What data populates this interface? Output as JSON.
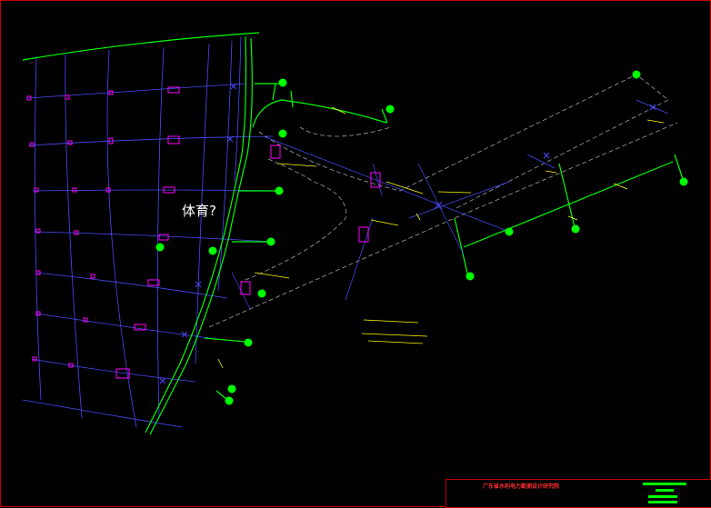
{
  "labels": {
    "big_text": "体育?"
  },
  "title_block": {
    "company": "广东省水利电力勘测设计研究院"
  },
  "colors": {
    "road_green": "#00ff00",
    "grid_blue": "#4a4aff",
    "marker_magenta": "#ff00ff",
    "annotation_yellow": "#ffff00",
    "frame_red": "#c00000",
    "dashed_gray": "#a0a0a0"
  }
}
